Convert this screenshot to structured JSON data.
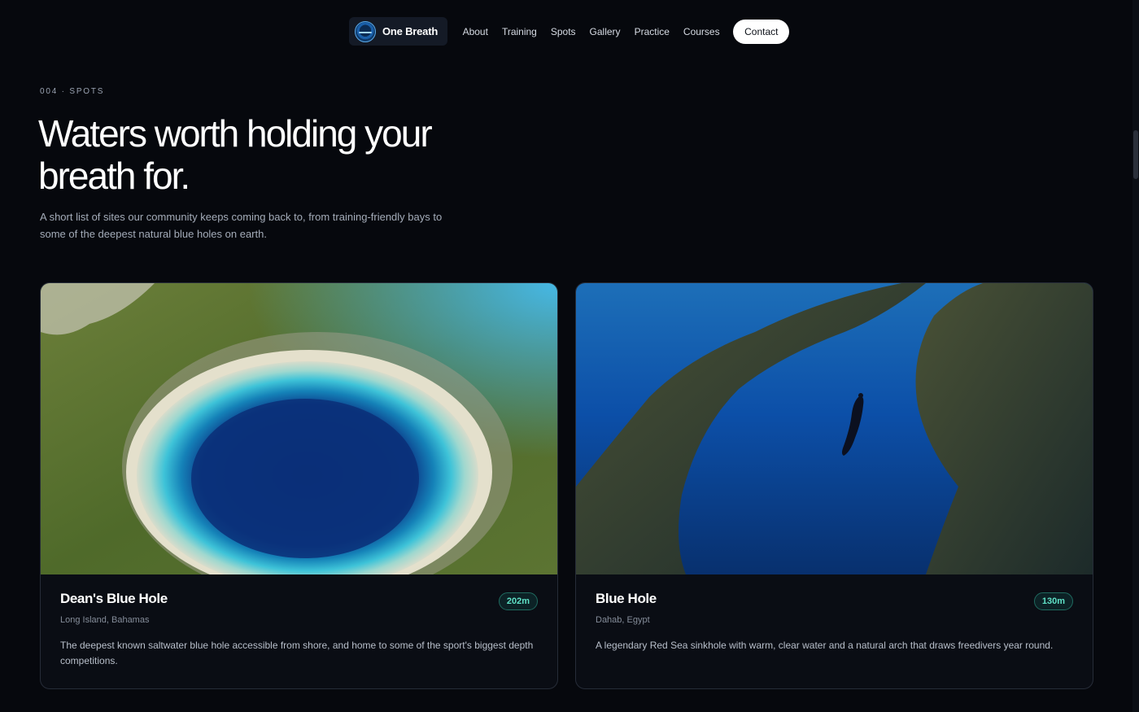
{
  "nav": {
    "brand": "One Breath",
    "links": [
      "About",
      "Training",
      "Spots",
      "Gallery",
      "Practice",
      "Courses"
    ],
    "contact": "Contact"
  },
  "section": {
    "eyebrow": "004 · SPOTS",
    "title": "Waters worth holding your breath for.",
    "lede": "A short list of sites our community keeps coming back to, from training-friendly bays to some of the deepest natural blue holes on earth."
  },
  "spots": [
    {
      "name": "Dean's Blue Hole",
      "location": "Long Island, Bahamas",
      "depth": "202m",
      "description": "The deepest known saltwater blue hole accessible from shore, and home to some of the sport's biggest depth competitions."
    },
    {
      "name": "Blue Hole",
      "location": "Dahab, Egypt",
      "depth": "130m",
      "description": "A legendary Red Sea sinkhole with warm, clear water and a natural arch that draws freedivers year round."
    }
  ],
  "colors": {
    "background": "#06080d",
    "accent_depth": "#5fe0c6",
    "brand_blue": "#5aa8e8"
  }
}
